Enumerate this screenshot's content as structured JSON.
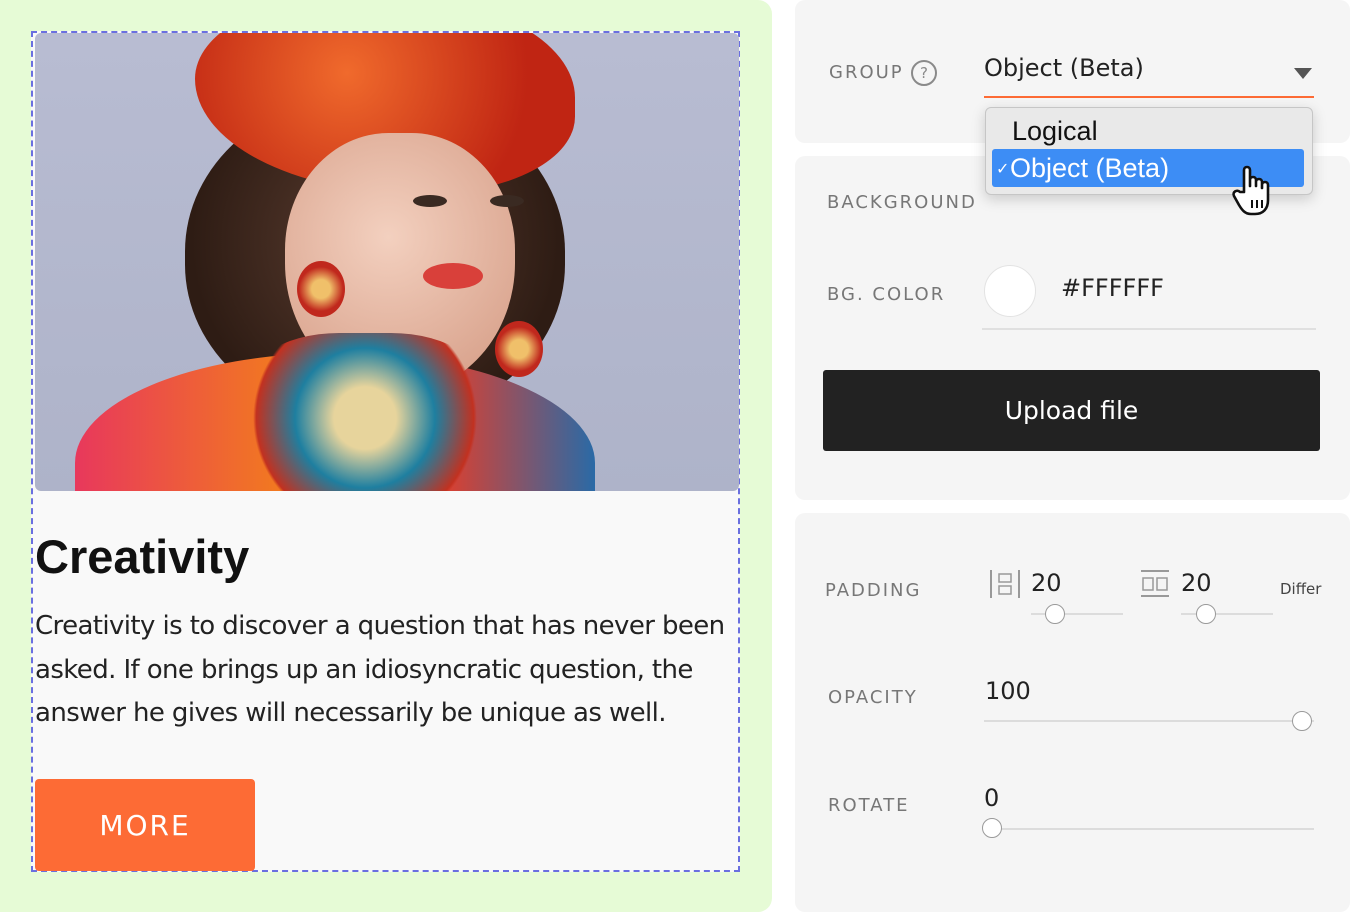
{
  "card": {
    "title": "Creativity",
    "text": "Creativity is to discover a question that has never been asked. If one brings up an idiosyncratic question, the answer he gives will necessarily be unique as well.",
    "button_label": "MORE"
  },
  "settings": {
    "group": {
      "label": "GROUP",
      "help": "?",
      "value": "Object (Beta)",
      "options": [
        {
          "label": "Logical",
          "selected": false
        },
        {
          "label": "Object (Beta)",
          "selected": true
        }
      ],
      "check_mark": "✓"
    },
    "background": {
      "label": "BACKGROUND",
      "color_label": "BG. COLOR",
      "color_value": "#FFFFFF",
      "upload_label": "Upload file"
    },
    "padding": {
      "label": "PADDING",
      "vertical": 20,
      "horizontal": 20,
      "mode": "Differ"
    },
    "opacity": {
      "label": "OPACITY",
      "value": 100,
      "max": 100
    },
    "rotate": {
      "label": "ROTATE",
      "value": 0
    }
  },
  "colors": {
    "accent": "#FD6B35",
    "canvas_bg": "#E6FBD6",
    "selection": "#3D8DF5",
    "dashed_border": "#6A6FE0"
  }
}
